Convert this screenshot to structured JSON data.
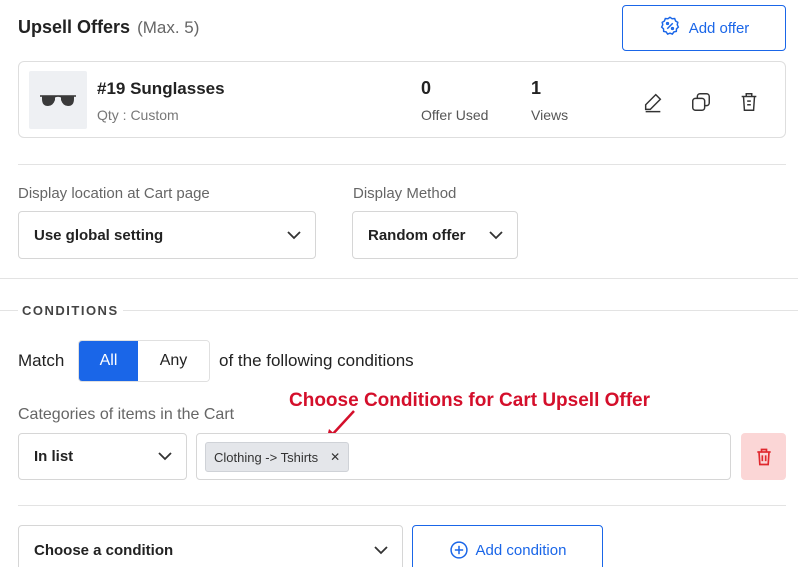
{
  "header": {
    "title": "Upsell Offers",
    "max_label": "(Max. 5)",
    "add_offer_label": "Add offer"
  },
  "offer": {
    "name": "#19 Sunglasses",
    "qty": "Qty : Custom",
    "offer_used_value": "0",
    "offer_used_label": "Offer Used",
    "views_value": "1",
    "views_label": "Views"
  },
  "display": {
    "location_label": "Display location at Cart page",
    "location_value": "Use global setting",
    "method_label": "Display Method",
    "method_value": "Random offer"
  },
  "conditions": {
    "heading": "CONDITIONS",
    "match_label": "Match",
    "match_options": [
      "All",
      "Any"
    ],
    "match_selected": "All",
    "match_suffix": "of the following conditions",
    "category_label": "Categories of items in the Cart",
    "operator_value": "In list",
    "tags": [
      "Clothing -> Tshirts"
    ],
    "choose_condition_value": "Choose a condition",
    "add_condition_label": "Add condition"
  },
  "annotation": {
    "text": "Choose Conditions for Cart Upsell Offer",
    "color": "#d40f2b"
  },
  "colors": {
    "accent": "#1a66e8",
    "danger_bg": "#fbd6d6",
    "danger": "#e0282e"
  }
}
